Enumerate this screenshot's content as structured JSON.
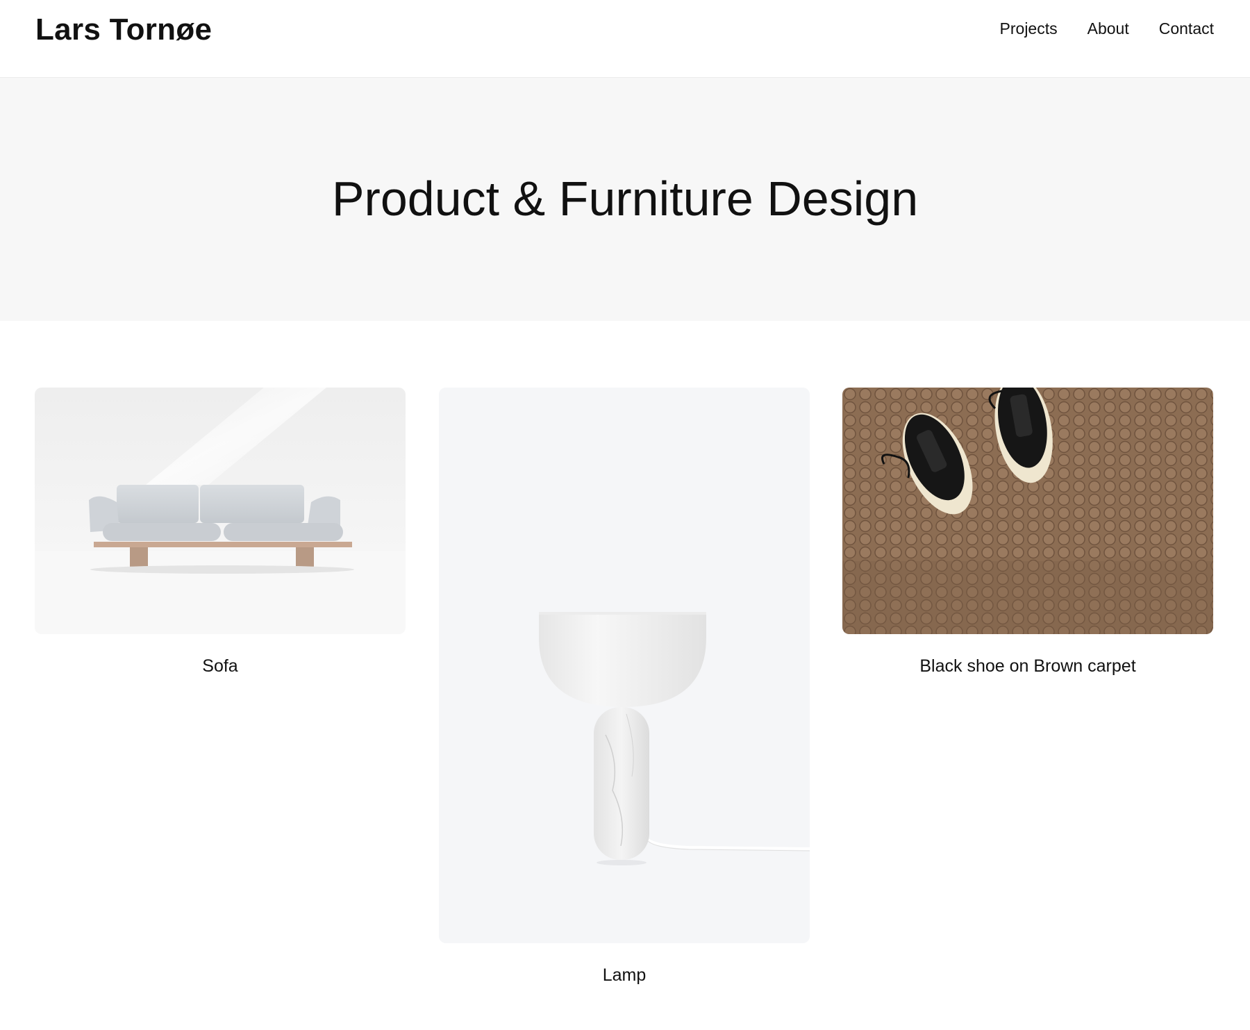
{
  "header": {
    "site_title": "Lars Tornøe",
    "nav": [
      {
        "label": "Projects"
      },
      {
        "label": "About"
      },
      {
        "label": "Contact"
      }
    ]
  },
  "hero": {
    "title": "Product & Furniture Design"
  },
  "projects": [
    {
      "title": "Sofa",
      "image": "sofa-photo"
    },
    {
      "title": "Lamp",
      "image": "lamp-photo"
    },
    {
      "title": "Black shoe on Brown carpet",
      "image": "shoes-on-carpet-photo"
    }
  ],
  "colors": {
    "text": "#111111",
    "hero_bg": "#f7f7f7",
    "page_bg": "#ffffff",
    "carpet": "#8a6b52"
  }
}
